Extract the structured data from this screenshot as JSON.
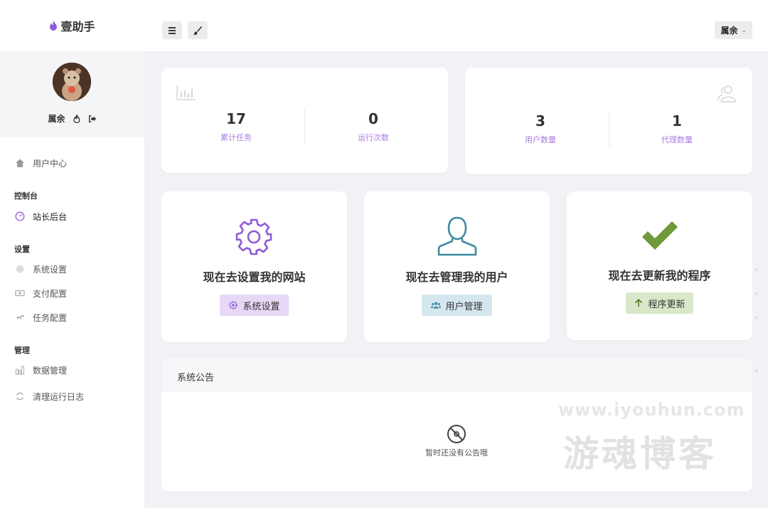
{
  "brand": {
    "name": "壹助手",
    "logo_icon": "flame-icon",
    "accent": "#8e5cd9"
  },
  "header": {
    "user_name": "属余",
    "menu_icon": "hamburger-icon",
    "theme_icon": "brush-icon"
  },
  "profile": {
    "name": "属余",
    "icons": [
      "flame-icon",
      "logout-icon"
    ]
  },
  "sidebar": {
    "user_center": "用户中心",
    "section_console": "控制台",
    "admin": "站长后台",
    "section_settings": "设置",
    "system_settings": "系统设置",
    "payment_settings": "支付配置",
    "task_settings": "任务配置",
    "section_manage": "管理",
    "data_management": "数据管理",
    "clear_logs": "清理运行日志"
  },
  "stats_left": {
    "total_tasks": {
      "value": "17",
      "label": "累计任务"
    },
    "run_count": {
      "value": "0",
      "label": "运行次数"
    }
  },
  "stats_right": {
    "user_count": {
      "value": "3",
      "label": "用户数量"
    },
    "agent_count": {
      "value": "1",
      "label": "代理数量"
    }
  },
  "actions": {
    "settings": {
      "title": "现在去设置我的网站",
      "button": "系统设置",
      "color": "#e6d8f6"
    },
    "users": {
      "title": "现在去管理我的用户",
      "button": "用户管理",
      "color": "#d4e6ee"
    },
    "update": {
      "title": "现在去更新我的程序",
      "button": "程序更新",
      "color": "#d9e8c8"
    }
  },
  "notice": {
    "title": "系统公告",
    "empty_text": "暂时还没有公告哦"
  },
  "watermark": {
    "url": "www.iyouhun.com",
    "name": "游魂博客"
  }
}
